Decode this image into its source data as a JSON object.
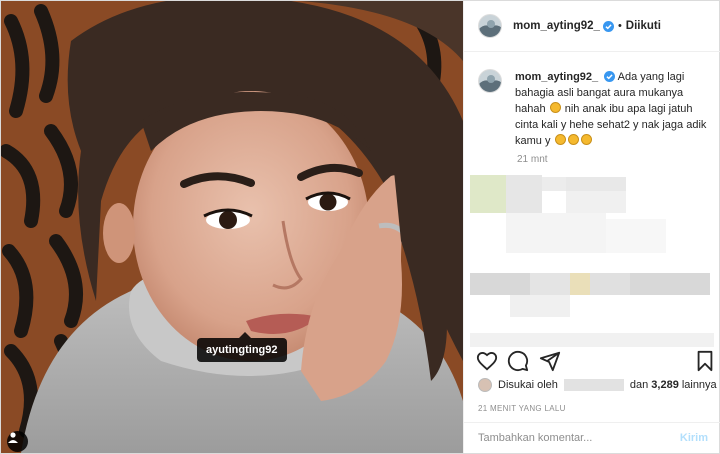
{
  "colors": {
    "verified": "#3897f0",
    "text": "#262626",
    "muted": "#8e8e8e",
    "post_disabled": "#b2dffc"
  },
  "photo": {
    "tag_label": "ayutingting92",
    "user_tag_icon": "person-icon"
  },
  "header": {
    "username": "mom_ayting92_",
    "separator": "•",
    "follow_label": "Diikuti"
  },
  "caption": {
    "username": "mom_ayting92_",
    "text_1": "Ada yang lagi bahagia asli bangat aura mukanya hahah",
    "text_2": "nih anak ibu apa lagi jatuh cinta kali y hehe sehat2 y nak jaga adik kamu y",
    "time": "21 mnt"
  },
  "likes": {
    "prefix": "Disukai oleh",
    "connector": "dan",
    "count": "3,289",
    "suffix": "lainnya"
  },
  "timestamp": "21 MENIT YANG LALU",
  "comment": {
    "placeholder": "Tambahkan komentar...",
    "post_label": "Kirim"
  }
}
